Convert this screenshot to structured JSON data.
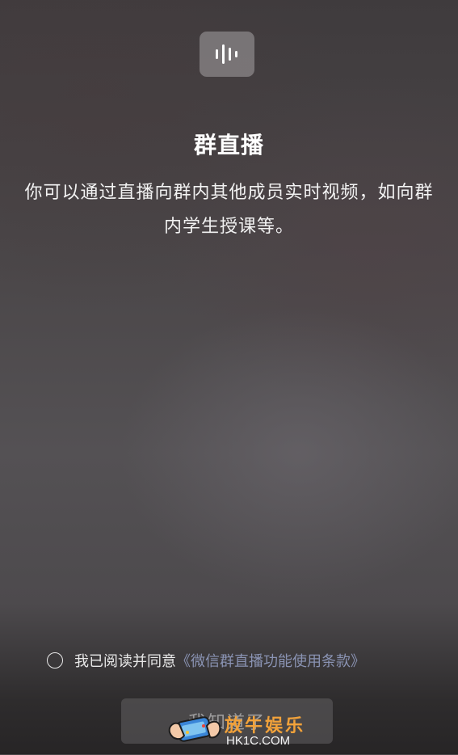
{
  "header": {
    "icon": "voice-wave-icon",
    "title": "群直播",
    "description": "你可以通过直播向群内其他成员实时视频，如向群内学生授课等。"
  },
  "agreement": {
    "prefix": "我已阅读并同意",
    "link_text": "《微信群直播功能使用条款》",
    "checked": false
  },
  "primary_button": {
    "label": "我知道了"
  },
  "watermark": {
    "brand": "放牛娱乐",
    "domain": "HK1C.COM"
  },
  "colors": {
    "link": "#8a93b3",
    "watermark_brand": "#f2a23a"
  }
}
